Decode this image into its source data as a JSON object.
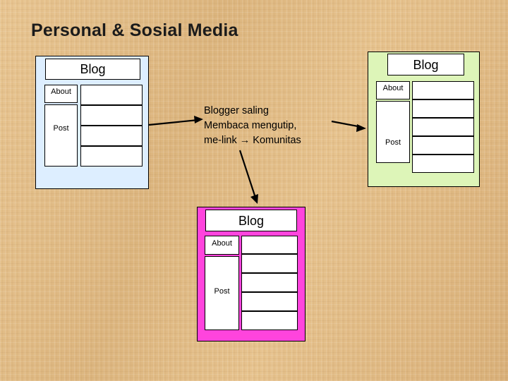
{
  "slide": {
    "title": "Personal & Sosial Media",
    "background_color": "#e0bb85"
  },
  "caption": {
    "line1": "Blogger saling",
    "line2": "Membaca mengutip,",
    "line3": "me-link → Komunitas"
  },
  "cards": [
    {
      "id": "blog-card-left",
      "title": "Blog",
      "about_label": "About",
      "post_label": "Post",
      "fill_color": "#ddeeff",
      "content_rows": 4
    },
    {
      "id": "blog-card-right",
      "title": "Blog",
      "about_label": "About",
      "post_label": "Post",
      "fill_color": "#ddf5b8",
      "content_rows": 5
    },
    {
      "id": "blog-card-bottom",
      "title": "Blog",
      "about_label": "About",
      "post_label": "Post",
      "fill_color": "#ff44dd",
      "content_rows": 5
    }
  ],
  "arrows": [
    {
      "name": "arrow-left-to-center",
      "from": "blog-card-left",
      "to": "caption"
    },
    {
      "name": "arrow-center-to-right",
      "from": "caption",
      "to": "blog-card-right"
    },
    {
      "name": "arrow-center-to-bottom",
      "from": "caption",
      "to": "blog-card-bottom"
    }
  ]
}
